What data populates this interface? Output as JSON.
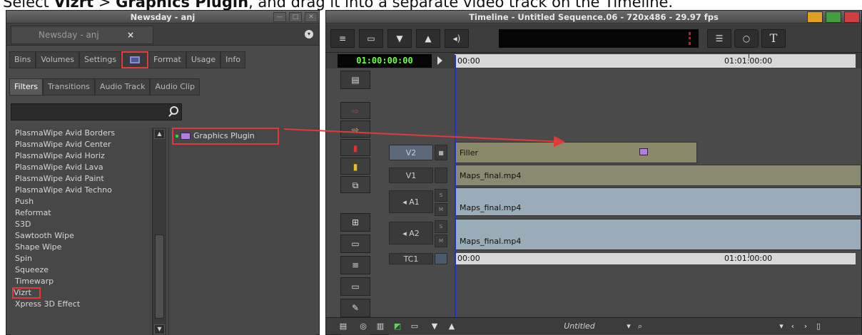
{
  "caption": {
    "prefix": "Select ",
    "vizrt": "Vizrt",
    "gt": " > ",
    "plugin": "Graphics Plugin",
    "suffix": ", and drag it into a separate video track on the Timeline."
  },
  "left_window": {
    "title": "Newsday - anj",
    "project_tab": "Newsday - anj",
    "close": "×",
    "tabs": [
      "Bins",
      "Volumes",
      "Settings",
      "",
      "Format",
      "Usage",
      "Info"
    ],
    "filter_tabs": [
      "Filters",
      "Transitions",
      "Audio Track",
      "Audio Clip"
    ],
    "list_items": [
      "PlasmaWipe Avid Borders",
      "PlasmaWipe Avid Center",
      "PlasmaWipe Avid Horiz",
      "PlasmaWipe Avid Lava",
      "PlasmaWipe Avid Paint",
      "PlasmaWipe Avid Techno",
      "Push",
      "Reformat",
      "S3D",
      "Sawtooth Wipe",
      "Shape Wipe",
      "Spin",
      "Squeeze",
      "Timewarp",
      "Vizrt",
      "Xpress 3D Effect"
    ],
    "effect_item": "Graphics Plugin"
  },
  "right_window": {
    "title": "Timeline - Untitled Sequence.06 - 720x486 - 29.97 fps",
    "text_tool": "T",
    "timecode": "01:00:00:00",
    "ruler_start": "00:00",
    "ruler_end": "01:01:00:00",
    "tracks": {
      "v2": {
        "label": "V2",
        "clip": "Filler"
      },
      "v1": {
        "label": "V1",
        "clip": "Maps_final.mp4"
      },
      "a1": {
        "label": "◂ A1",
        "clip": "Maps_final.mp4"
      },
      "a2": {
        "label": "◂ A2",
        "clip": "Maps_final.mp4"
      },
      "tc1": {
        "label": "TC1"
      }
    },
    "solo": "S",
    "mute": "M",
    "sequence_name": "Untitled"
  },
  "colors": {
    "highlight": "#e03a3a",
    "timecode_green": "#6cff3a",
    "playhead": "#2030d0"
  }
}
